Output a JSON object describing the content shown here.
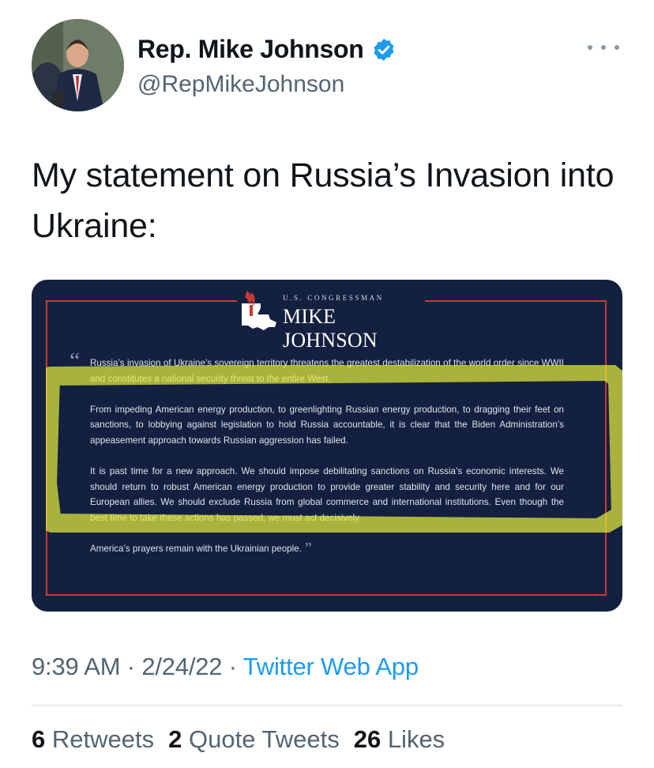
{
  "author": {
    "display_name": "Rep. Mike Johnson",
    "handle": "@RepMikeJohnson"
  },
  "tweet": {
    "text": "My statement on Russia’s Invasion into Ukraine:"
  },
  "media": {
    "letterhead_small": "U.S. CONGRESSMAN",
    "letterhead_big": "MIKE JOHNSON",
    "paragraphs": [
      "Russia’s invasion of Ukraine’s sovereign territory threatens the greatest destabilization of the world order since WWII and constitutes a national security threat to the entire West.",
      "From impeding American energy production, to greenlighting Russian energy production, to dragging their feet on sanctions, to lobbying against legislation to hold Russia accountable, it is clear that the Biden Administration’s appeasement approach towards Russian aggression has failed.",
      "It is past time for a new approach. We should impose debilitating sanctions on Russia’s economic interests. We should return to robust American energy production to provide greater stability and security here and for our European allies. We should exclude Russia from global commerce and international institutions. Even though the best time to take these actions has passed, we must act decisively.",
      "America’s prayers remain with the Ukrainian people."
    ],
    "colors": {
      "background": "#13203f",
      "frame": "#c93a32",
      "highlight": "#e3ea3c"
    }
  },
  "meta": {
    "time": "9:39 AM",
    "separator": "·",
    "date": "2/24/22",
    "source": "Twitter Web App"
  },
  "stats": {
    "retweets_count": "6",
    "retweets_label": "Retweets",
    "quotes_count": "2",
    "quotes_label": "Quote Tweets",
    "likes_count": "26",
    "likes_label": "Likes"
  },
  "icons": [
    "verified-badge-icon",
    "more-options-icon",
    "louisiana-state-icon",
    "torch-icon"
  ]
}
